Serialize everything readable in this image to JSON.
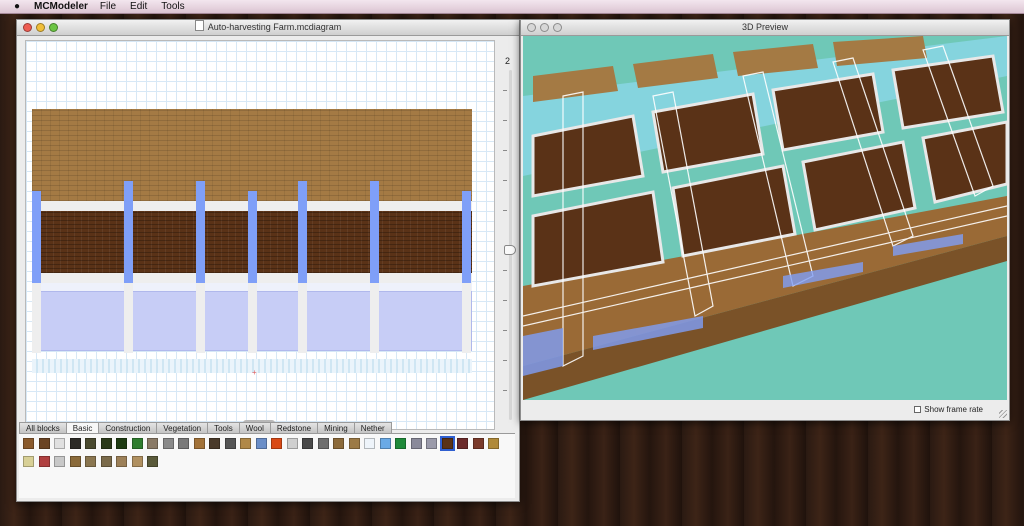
{
  "menubar": {
    "app_name": "MCModeler",
    "menus": [
      "File",
      "Edit",
      "Tools"
    ]
  },
  "editor_window": {
    "title": "Auto-harvesting Farm.mcdiagram",
    "layer_number": "2",
    "tabs": [
      "All blocks",
      "Basic",
      "Construction",
      "Vegetation",
      "Tools",
      "Wool",
      "Redstone",
      "Mining",
      "Nether"
    ],
    "active_tab": "Basic"
  },
  "preview_window": {
    "title": "3D Preview",
    "show_frame_rate_label": "Show frame rate"
  },
  "colors": {
    "planks": "#a47a44",
    "dirt": "#5a3217",
    "water": "#7f9ff8",
    "glass": "#c7cdf6",
    "snow": "#eeeeee",
    "selection": "#2f5fd0"
  },
  "palette": {
    "row1": [
      "#8a5a2c",
      "#6b4423",
      "#e0e0e0",
      "#2c2a26",
      "#4a4a30",
      "#2b3a1a",
      "#1e3b12",
      "#2f7d2f",
      "#8a7a66",
      "#8a8a8a",
      "#7a7a7a",
      "#a27238",
      "#4a3a2a",
      "#555555",
      "#b08848",
      "#6a8ec8",
      "#d94a16",
      "#cfcfcf",
      "#4a4a4a",
      "#6e6e6e",
      "#8c6a3a",
      "#9c7a46",
      "#eef4fa",
      "#6aaae6",
      "#1f8a3a",
      "#8a8a9a",
      "#9a9aaa",
      "#5a3217",
      "#6b2a2a",
      "#7a3a2a",
      "#b08a3a"
    ],
    "row2": [
      "#d8d096",
      "#b04040",
      "#c8c8c8",
      "#8a6a3a",
      "#8a7650",
      "#7a6a4a",
      "#9c8058",
      "#b09060",
      "#5a5a3a"
    ],
    "selected_index": 27
  }
}
